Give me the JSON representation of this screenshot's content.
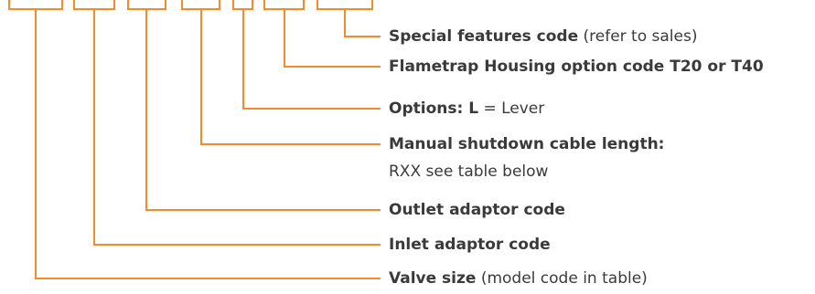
{
  "diagram": {
    "line_color": "#f28c28",
    "text_color": "#3a3a3a",
    "callouts": [
      {
        "id": "special-features",
        "bold": "Special features code",
        "normal": " (refer to sales)"
      },
      {
        "id": "flametrap-housing",
        "bold": "Flametrap Housing option code T20 or T40",
        "normal": ""
      },
      {
        "id": "options",
        "bold": "Options: ",
        "bold2": "L",
        "normal": " = Lever"
      },
      {
        "id": "manual-shutdown",
        "bold": "Manual shutdown cable length:",
        "normal": "",
        "line2": "RXX see table below"
      },
      {
        "id": "outlet-adaptor",
        "bold": "Outlet adaptor code",
        "normal": ""
      },
      {
        "id": "inlet-adaptor",
        "bold": "Inlet adaptor code",
        "normal": ""
      },
      {
        "id": "valve-size",
        "bold": "Valve size",
        "normal": " (model code in table)"
      }
    ]
  }
}
